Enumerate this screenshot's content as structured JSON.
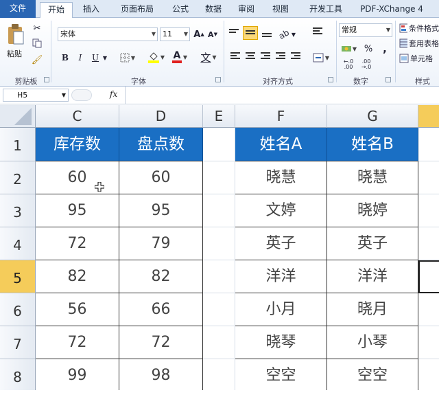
{
  "ribbon": {
    "tabs": [
      "文件",
      "开始",
      "插入",
      "页面布局",
      "公式",
      "数据",
      "审阅",
      "视图",
      "开发工具",
      "PDF-XChange 4"
    ],
    "clipboard": {
      "paste_label": "粘贴",
      "group_label": "剪贴板"
    },
    "font": {
      "name": "宋体",
      "size": "11",
      "bold": "B",
      "italic": "I",
      "underline": "U",
      "font_color_glyph": "A",
      "phonetic_glyph": "文",
      "group_label": "字体"
    },
    "alignment": {
      "group_label": "对齐方式"
    },
    "number": {
      "format": "常规",
      "percent": "%",
      "comma": ",",
      "group_label": "数字"
    },
    "styles": {
      "conditional_format": "条件格式",
      "table_format": "套用表格",
      "cell_style": "单元格",
      "group_label": "样式"
    }
  },
  "formula_bar": {
    "name_box": "H5",
    "fx": "fx",
    "formula": ""
  },
  "grid": {
    "columns": [
      "C",
      "D",
      "E",
      "F",
      "G"
    ],
    "rows": [
      "1",
      "2",
      "3",
      "4",
      "5",
      "6",
      "7",
      "8"
    ],
    "selected_row": "5",
    "headers": {
      "C": "库存数",
      "D": "盘点数",
      "F": "姓名A",
      "G": "姓名B"
    },
    "data": [
      {
        "C": "60",
        "D": "60",
        "F": "晓慧",
        "G": "晓慧"
      },
      {
        "C": "95",
        "D": "95",
        "F": "文婷",
        "G": "晓婷"
      },
      {
        "C": "72",
        "D": "79",
        "F": "英子",
        "G": "英子"
      },
      {
        "C": "82",
        "D": "82",
        "F": "洋洋",
        "G": "洋洋"
      },
      {
        "C": "56",
        "D": "66",
        "F": "小月",
        "G": "晓月"
      },
      {
        "C": "72",
        "D": "72",
        "F": "晓琴",
        "G": "小琴"
      },
      {
        "C": "99",
        "D": "98",
        "F": "空空",
        "G": "空空"
      }
    ]
  },
  "colors": {
    "header_fill": "#1a6fc4",
    "selected_header": "#f5cc5a",
    "file_tab": "#2a66b3"
  }
}
